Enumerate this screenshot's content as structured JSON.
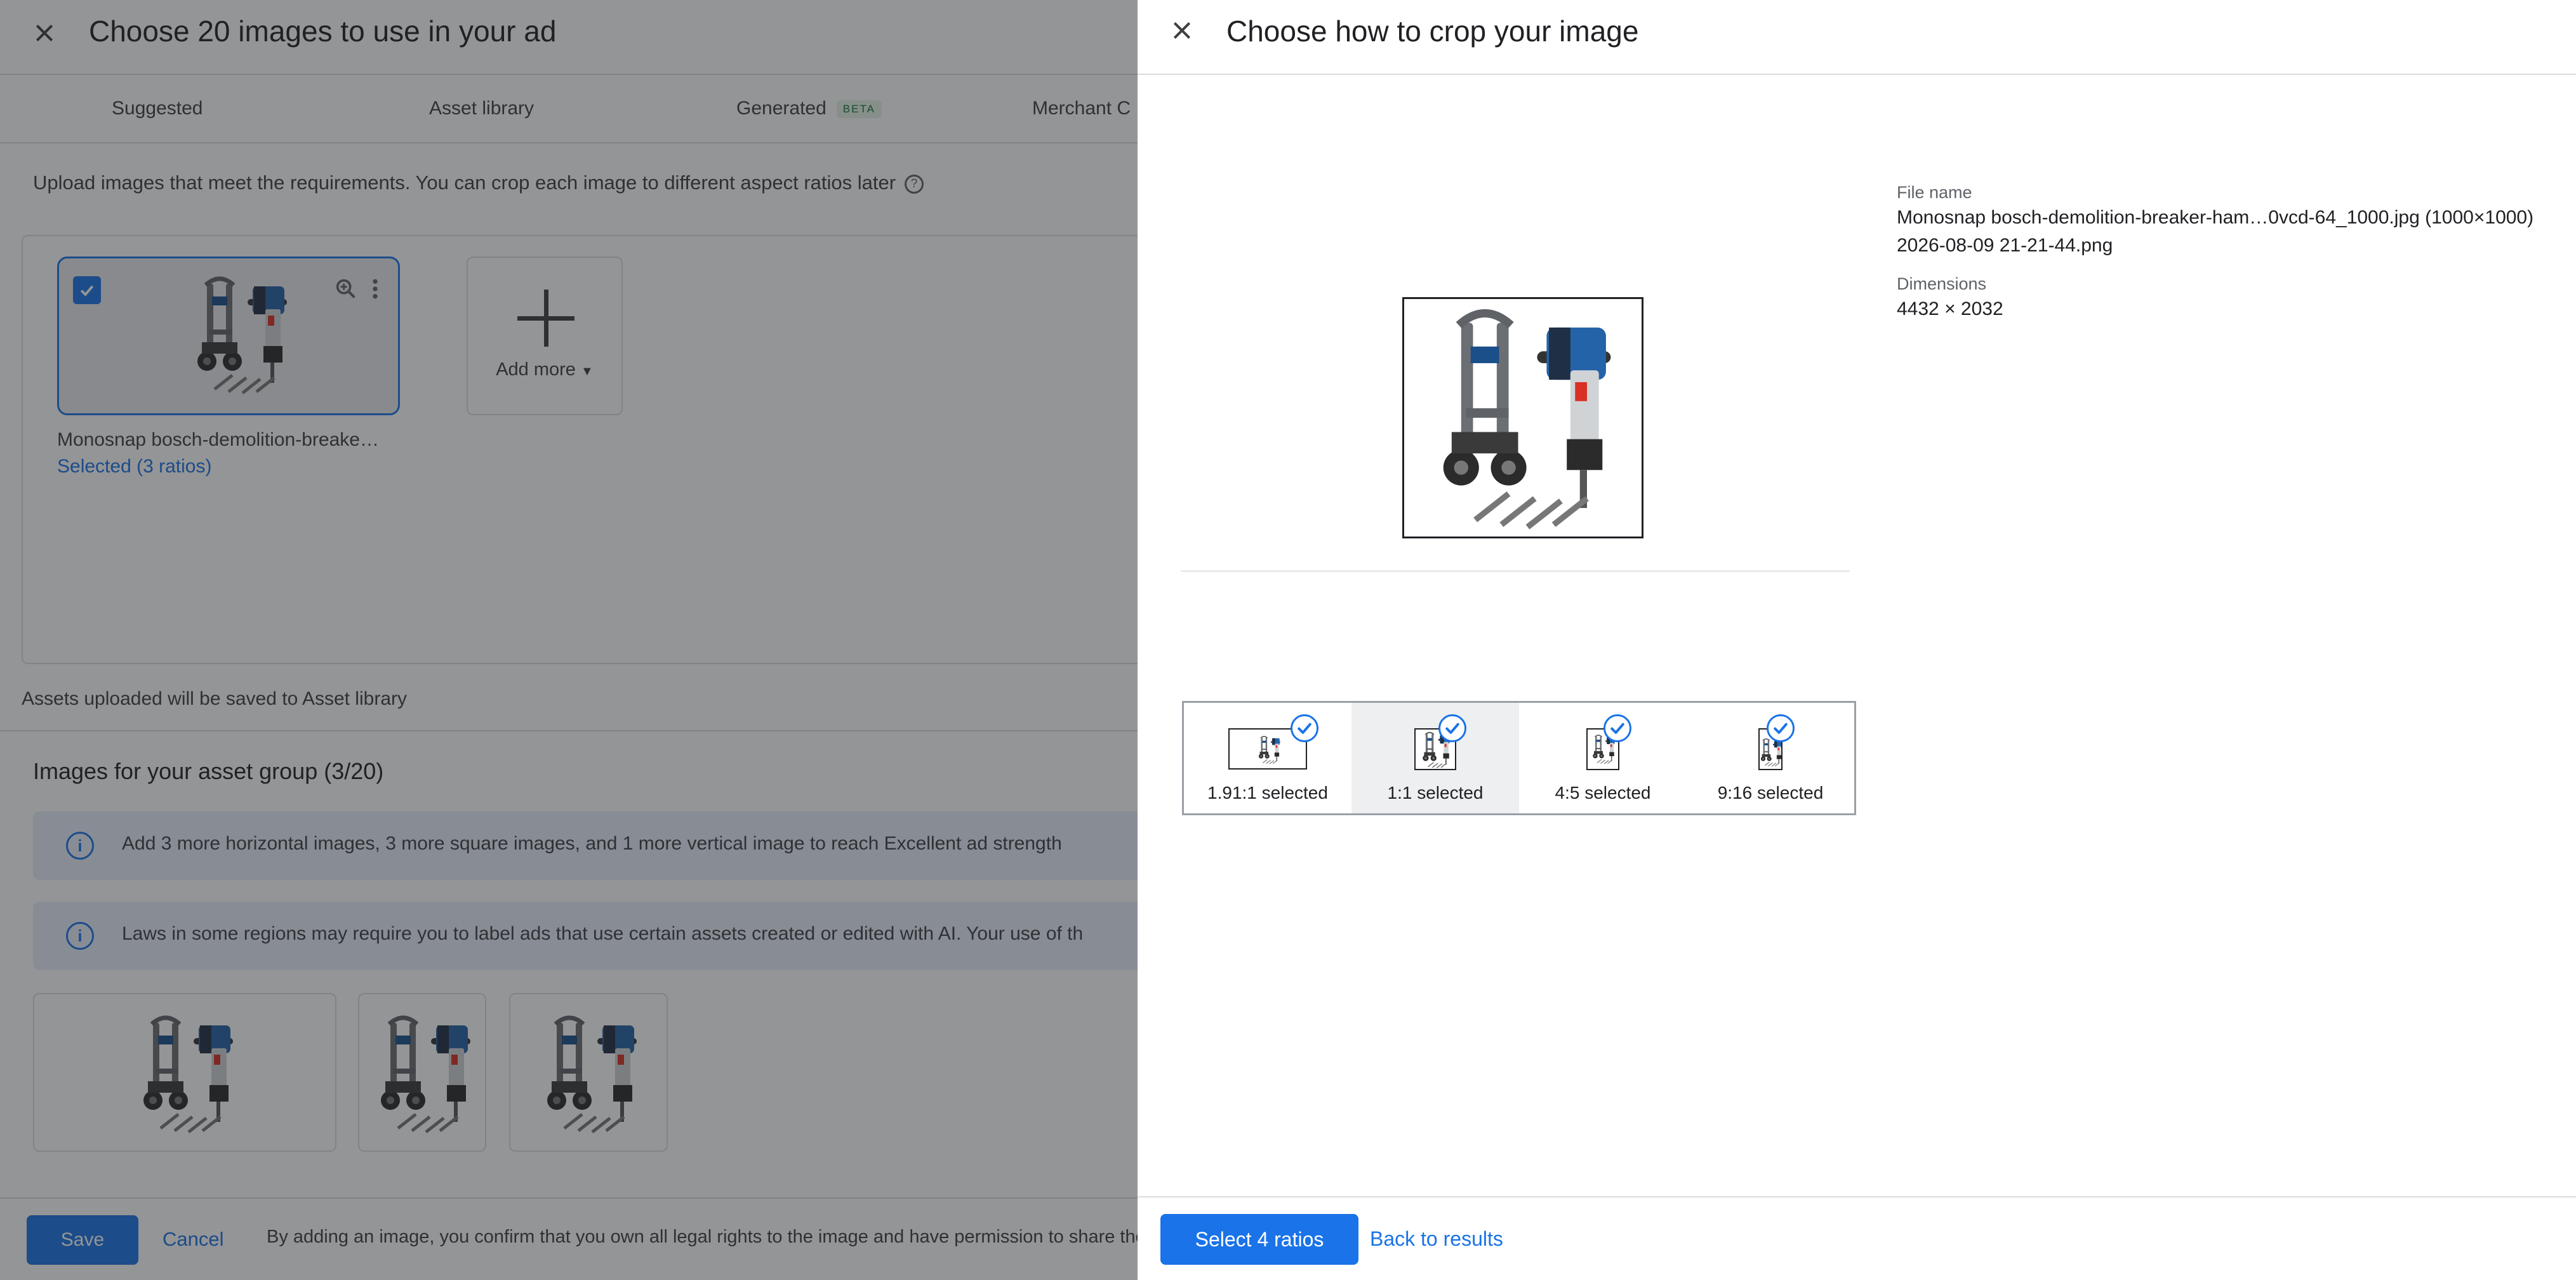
{
  "background_dialog": {
    "title": "Choose 20 images to use in your ad",
    "tabs": [
      {
        "label": "Suggested"
      },
      {
        "label": "Asset library"
      },
      {
        "label": "Generated",
        "badge": "BETA"
      },
      {
        "label": "Merchant C"
      }
    ],
    "upload_note": "Upload images that meet the requirements. You can crop each image to different aspect ratios later",
    "selected_card": {
      "name": "Monosnap bosch-demolition-breake…",
      "status": "Selected (3 ratios)"
    },
    "add_more_label": "Add more",
    "saved_note": "Assets uploaded will be saved to Asset library",
    "group_title": "Images for your asset group (3/20)",
    "banners": [
      "Add 3 more horizontal images, 3 more square images, and 1 more vertical image to reach Excellent ad strength",
      "Laws in some regions may require you to label ads that use certain assets created or edited with AI. Your use of th"
    ],
    "save_label": "Save",
    "cancel_label": "Cancel",
    "legal_text": "By adding an image, you confirm that you own all legal rights to the image and have permission to share the"
  },
  "crop_panel": {
    "title": "Choose how to crop your image",
    "file_name_label": "File name",
    "file_name_line1": "Monosnap bosch-demolition-breaker-ham…0vcd-64_1000.jpg (1000×1000)",
    "file_name_line2": "2026-08-09 21-21-44.png",
    "dimensions_label": "Dimensions",
    "dimensions_value": "4432 × 2032",
    "ratios": [
      {
        "label": "1.91:1 selected"
      },
      {
        "label": "1:1 selected"
      },
      {
        "label": "4:5 selected"
      },
      {
        "label": "9:16 selected"
      }
    ],
    "primary_button": "Select 4 ratios",
    "secondary_button": "Back to results"
  },
  "colors": {
    "accent": "#1a73e8",
    "scrim": "#202124",
    "banner_bg": "#e8f0fe"
  }
}
